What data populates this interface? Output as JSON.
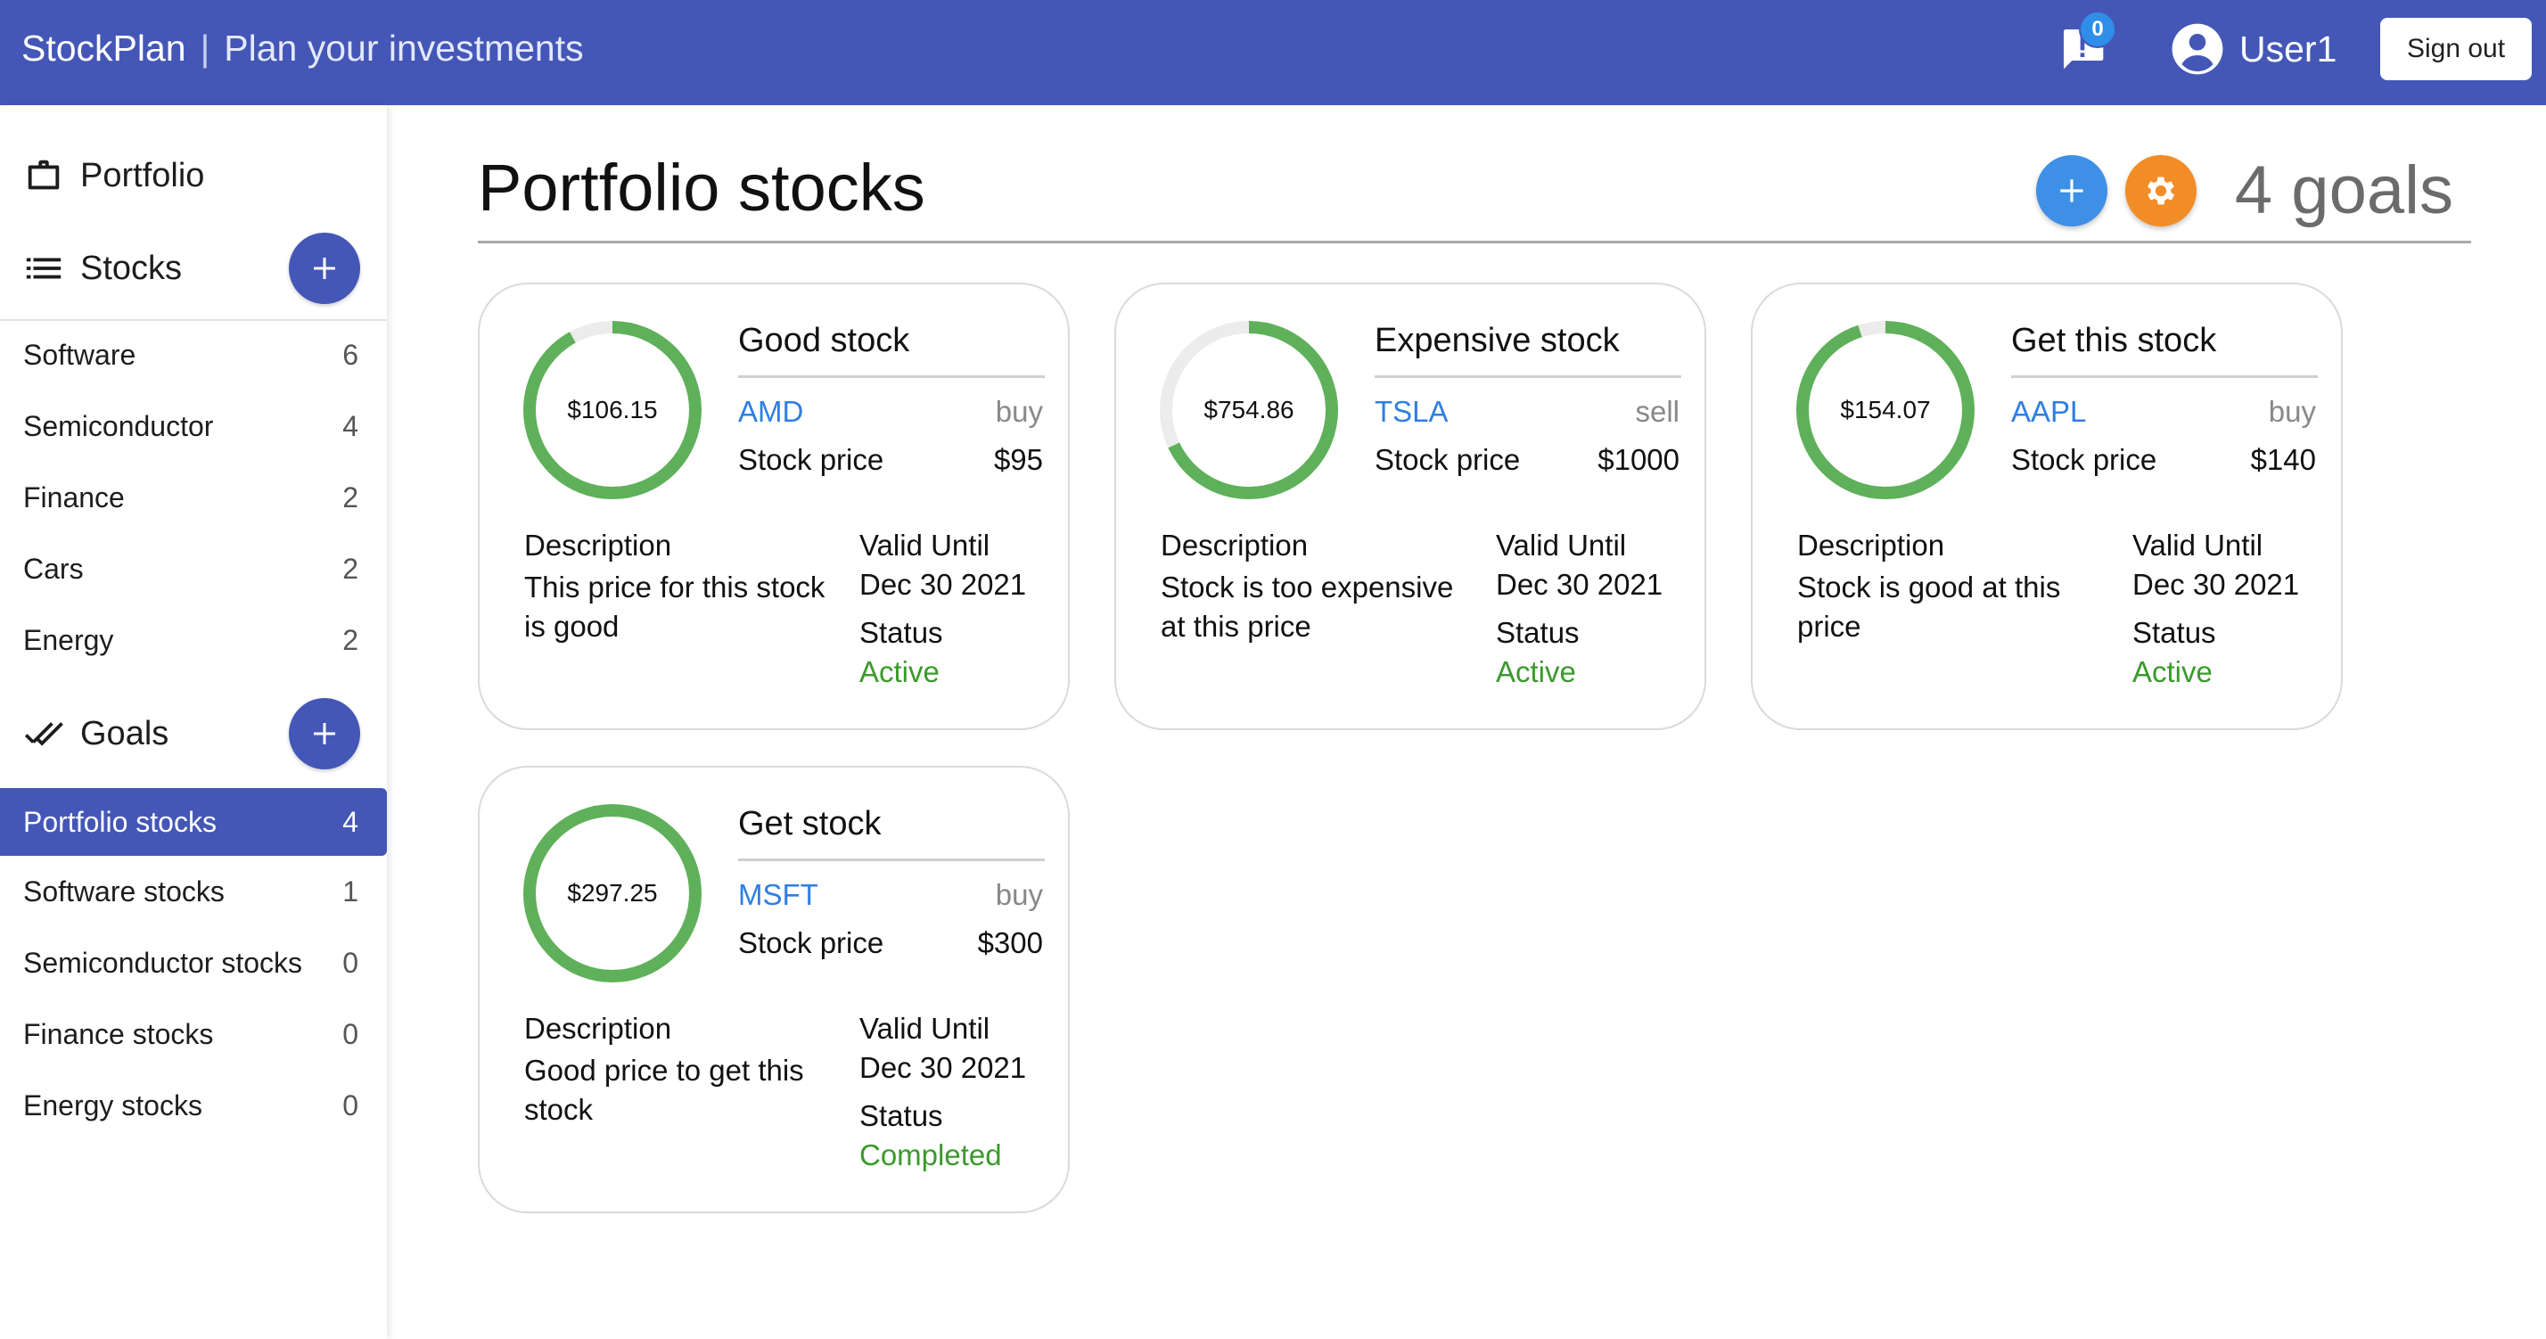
{
  "header": {
    "brand": "StockPlan",
    "separator": "|",
    "tagline": "Plan your investments",
    "notification_count": "0",
    "user_name": "User1",
    "sign_out_label": "Sign out",
    "bar_color": "#4457b7"
  },
  "sidebar": {
    "portfolio_label": "Portfolio",
    "stocks_label": "Stocks",
    "stock_categories": [
      {
        "label": "Software",
        "count": "6"
      },
      {
        "label": "Semiconductor",
        "count": "4"
      },
      {
        "label": "Finance",
        "count": "2"
      },
      {
        "label": "Cars",
        "count": "2"
      },
      {
        "label": "Energy",
        "count": "2"
      }
    ],
    "goals_label": "Goals",
    "goal_lists": [
      {
        "label": "Portfolio stocks",
        "count": "4",
        "active": true
      },
      {
        "label": "Software stocks",
        "count": "1"
      },
      {
        "label": "Semiconductor stocks",
        "count": "0"
      },
      {
        "label": "Finance stocks",
        "count": "0"
      },
      {
        "label": "Energy stocks",
        "count": "0"
      }
    ]
  },
  "main": {
    "title": "Portfolio stocks",
    "goal_count_label": "4 goals",
    "add_button_icon": "plus-icon",
    "settings_button_icon": "gear-icon",
    "cards": [
      {
        "current_price": "$106.15",
        "progress": 0.92,
        "title": "Good stock",
        "ticker": "AMD",
        "action": "buy",
        "stock_price_label": "Stock price",
        "stock_price": "$95",
        "description_label": "Description",
        "description": "This price for this stock is good",
        "valid_until_label": "Valid Until",
        "valid_until": "Dec 30 2021",
        "status_label": "Status",
        "status": "Active"
      },
      {
        "current_price": "$754.86",
        "progress": 0.68,
        "title": "Expensive stock",
        "ticker": "TSLA",
        "action": "sell",
        "stock_price_label": "Stock price",
        "stock_price": "$1000",
        "description_label": "Description",
        "description": "Stock is too expensive at this price",
        "valid_until_label": "Valid Until",
        "valid_until": "Dec 30 2021",
        "status_label": "Status",
        "status": "Active"
      },
      {
        "current_price": "$154.07",
        "progress": 0.95,
        "title": "Get this stock",
        "ticker": "AAPL",
        "action": "buy",
        "stock_price_label": "Stock price",
        "stock_price": "$140",
        "description_label": "Description",
        "description": "Stock is good at this price",
        "valid_until_label": "Valid Until",
        "valid_until": "Dec 30 2021",
        "status_label": "Status",
        "status": "Active"
      },
      {
        "current_price": "$297.25",
        "progress": 1.0,
        "title": "Get stock",
        "ticker": "MSFT",
        "action": "buy",
        "stock_price_label": "Stock price",
        "stock_price": "$300",
        "description_label": "Description",
        "description": "Good price to get this stock",
        "valid_until_label": "Valid Until",
        "valid_until": "Dec 30 2021",
        "status_label": "Status",
        "status": "Completed"
      }
    ]
  },
  "colors": {
    "accent": "#4457b7",
    "ring_progress": "#5fb05a",
    "ring_track": "#ececec",
    "ticker_link": "#2f7fe0",
    "status_active": "#3b9a2c",
    "fab_add": "#3e8fe6",
    "fab_settings": "#f28c26"
  }
}
